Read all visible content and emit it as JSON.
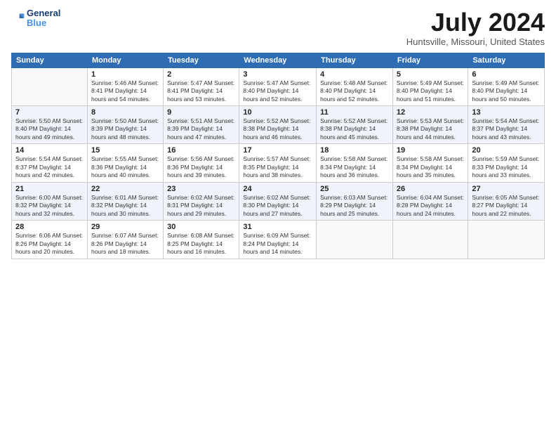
{
  "header": {
    "logo_line1": "General",
    "logo_line2": "Blue",
    "main_title": "July 2024",
    "subtitle": "Huntsville, Missouri, United States"
  },
  "days_of_week": [
    "Sunday",
    "Monday",
    "Tuesday",
    "Wednesday",
    "Thursday",
    "Friday",
    "Saturday"
  ],
  "weeks": [
    [
      {
        "day": "",
        "info": ""
      },
      {
        "day": "1",
        "info": "Sunrise: 5:46 AM\nSunset: 8:41 PM\nDaylight: 14 hours\nand 54 minutes."
      },
      {
        "day": "2",
        "info": "Sunrise: 5:47 AM\nSunset: 8:41 PM\nDaylight: 14 hours\nand 53 minutes."
      },
      {
        "day": "3",
        "info": "Sunrise: 5:47 AM\nSunset: 8:40 PM\nDaylight: 14 hours\nand 52 minutes."
      },
      {
        "day": "4",
        "info": "Sunrise: 5:48 AM\nSunset: 8:40 PM\nDaylight: 14 hours\nand 52 minutes."
      },
      {
        "day": "5",
        "info": "Sunrise: 5:49 AM\nSunset: 8:40 PM\nDaylight: 14 hours\nand 51 minutes."
      },
      {
        "day": "6",
        "info": "Sunrise: 5:49 AM\nSunset: 8:40 PM\nDaylight: 14 hours\nand 50 minutes."
      }
    ],
    [
      {
        "day": "7",
        "info": "Sunrise: 5:50 AM\nSunset: 8:40 PM\nDaylight: 14 hours\nand 49 minutes."
      },
      {
        "day": "8",
        "info": "Sunrise: 5:50 AM\nSunset: 8:39 PM\nDaylight: 14 hours\nand 48 minutes."
      },
      {
        "day": "9",
        "info": "Sunrise: 5:51 AM\nSunset: 8:39 PM\nDaylight: 14 hours\nand 47 minutes."
      },
      {
        "day": "10",
        "info": "Sunrise: 5:52 AM\nSunset: 8:38 PM\nDaylight: 14 hours\nand 46 minutes."
      },
      {
        "day": "11",
        "info": "Sunrise: 5:52 AM\nSunset: 8:38 PM\nDaylight: 14 hours\nand 45 minutes."
      },
      {
        "day": "12",
        "info": "Sunrise: 5:53 AM\nSunset: 8:38 PM\nDaylight: 14 hours\nand 44 minutes."
      },
      {
        "day": "13",
        "info": "Sunrise: 5:54 AM\nSunset: 8:37 PM\nDaylight: 14 hours\nand 43 minutes."
      }
    ],
    [
      {
        "day": "14",
        "info": "Sunrise: 5:54 AM\nSunset: 8:37 PM\nDaylight: 14 hours\nand 42 minutes."
      },
      {
        "day": "15",
        "info": "Sunrise: 5:55 AM\nSunset: 8:36 PM\nDaylight: 14 hours\nand 40 minutes."
      },
      {
        "day": "16",
        "info": "Sunrise: 5:56 AM\nSunset: 8:36 PM\nDaylight: 14 hours\nand 39 minutes."
      },
      {
        "day": "17",
        "info": "Sunrise: 5:57 AM\nSunset: 8:35 PM\nDaylight: 14 hours\nand 38 minutes."
      },
      {
        "day": "18",
        "info": "Sunrise: 5:58 AM\nSunset: 8:34 PM\nDaylight: 14 hours\nand 36 minutes."
      },
      {
        "day": "19",
        "info": "Sunrise: 5:58 AM\nSunset: 8:34 PM\nDaylight: 14 hours\nand 35 minutes."
      },
      {
        "day": "20",
        "info": "Sunrise: 5:59 AM\nSunset: 8:33 PM\nDaylight: 14 hours\nand 33 minutes."
      }
    ],
    [
      {
        "day": "21",
        "info": "Sunrise: 6:00 AM\nSunset: 8:32 PM\nDaylight: 14 hours\nand 32 minutes."
      },
      {
        "day": "22",
        "info": "Sunrise: 6:01 AM\nSunset: 8:32 PM\nDaylight: 14 hours\nand 30 minutes."
      },
      {
        "day": "23",
        "info": "Sunrise: 6:02 AM\nSunset: 8:31 PM\nDaylight: 14 hours\nand 29 minutes."
      },
      {
        "day": "24",
        "info": "Sunrise: 6:02 AM\nSunset: 8:30 PM\nDaylight: 14 hours\nand 27 minutes."
      },
      {
        "day": "25",
        "info": "Sunrise: 6:03 AM\nSunset: 8:29 PM\nDaylight: 14 hours\nand 25 minutes."
      },
      {
        "day": "26",
        "info": "Sunrise: 6:04 AM\nSunset: 8:28 PM\nDaylight: 14 hours\nand 24 minutes."
      },
      {
        "day": "27",
        "info": "Sunrise: 6:05 AM\nSunset: 8:27 PM\nDaylight: 14 hours\nand 22 minutes."
      }
    ],
    [
      {
        "day": "28",
        "info": "Sunrise: 6:06 AM\nSunset: 8:26 PM\nDaylight: 14 hours\nand 20 minutes."
      },
      {
        "day": "29",
        "info": "Sunrise: 6:07 AM\nSunset: 8:26 PM\nDaylight: 14 hours\nand 18 minutes."
      },
      {
        "day": "30",
        "info": "Sunrise: 6:08 AM\nSunset: 8:25 PM\nDaylight: 14 hours\nand 16 minutes."
      },
      {
        "day": "31",
        "info": "Sunrise: 6:09 AM\nSunset: 8:24 PM\nDaylight: 14 hours\nand 14 minutes."
      },
      {
        "day": "",
        "info": ""
      },
      {
        "day": "",
        "info": ""
      },
      {
        "day": "",
        "info": ""
      }
    ]
  ]
}
